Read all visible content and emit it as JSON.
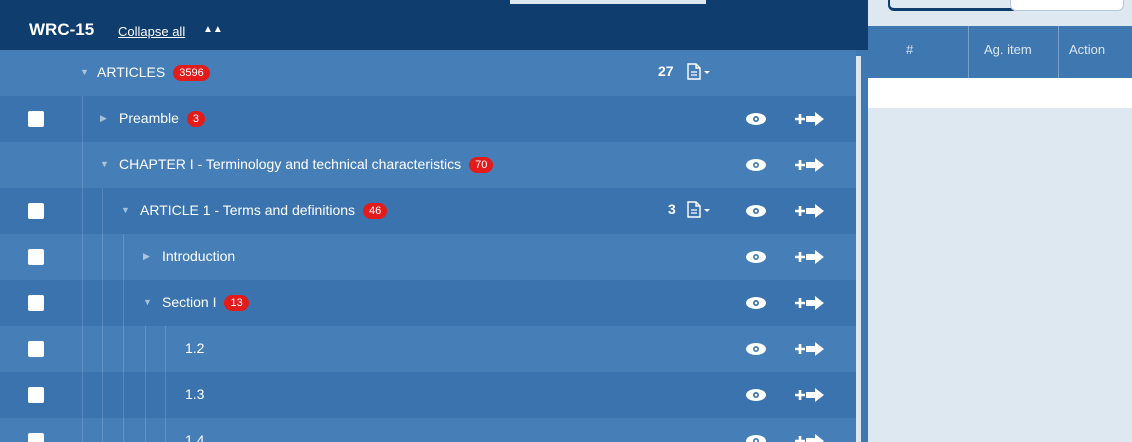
{
  "header": {
    "title": "WRC-15",
    "collapse_label": "Collapse all"
  },
  "tree": [
    {
      "label": "ARTICLES",
      "badge": "3596",
      "count": "27",
      "checkbox": false
    },
    {
      "label": "Preamble",
      "badge": "3",
      "checkbox": true
    },
    {
      "label": "CHAPTER I - Terminology and technical characteristics",
      "badge": "70",
      "checkbox": false
    },
    {
      "label": "ARTICLE 1 - Terms and definitions",
      "badge": "46",
      "count": "3",
      "checkbox": true
    },
    {
      "label": "Introduction",
      "checkbox": true
    },
    {
      "label": "Section I",
      "badge": "13",
      "checkbox": true
    },
    {
      "label": "1.2",
      "checkbox": true
    },
    {
      "label": "1.3",
      "checkbox": true
    },
    {
      "label": "1.4",
      "checkbox": true
    }
  ],
  "right_table": {
    "columns": [
      "#",
      "Ag. item",
      "Action"
    ]
  },
  "colors": {
    "header": "#0e3d6e",
    "panel": "#3f77b0",
    "badge": "#e31b1b",
    "right_bg": "#dde8f0"
  },
  "icons": [
    "collapse-up-icon",
    "expand-triangle-icon",
    "eye-icon",
    "add-arrow-icon",
    "document-dropdown-icon"
  ]
}
